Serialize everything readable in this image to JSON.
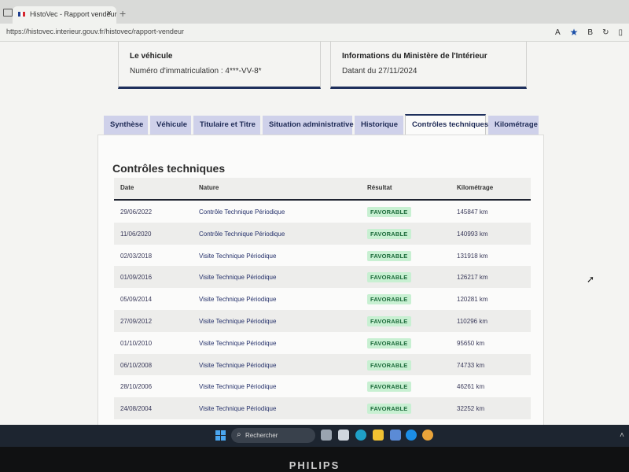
{
  "browser": {
    "tab_title": "HistoVec - Rapport vendeur",
    "tab_close": "×",
    "new_tab": "+",
    "url": "https://histovec.interieur.gouv.fr/histovec/rapport-vendeur",
    "toolbar": {
      "read_aloud": "A",
      "favorite": "★",
      "profile_b": "B",
      "refresh": "↻",
      "split": "▯"
    }
  },
  "cards": {
    "vehicle": {
      "title": "Le véhicule",
      "text": "Numéro d'immatriculation : 4***-VV-8*"
    },
    "ministry": {
      "title": "Informations du Ministère de l'Intérieur",
      "text": "Datant du 27/11/2024"
    }
  },
  "tabs": [
    {
      "label": "Synthèse"
    },
    {
      "label": "Véhicule"
    },
    {
      "label": "Titulaire et Titre"
    },
    {
      "label": "Situation administrative"
    },
    {
      "label": "Historique"
    },
    {
      "label": "Contrôles techniques",
      "active": true
    },
    {
      "label": "Kilométrage"
    }
  ],
  "section": {
    "title": "Contrôles techniques"
  },
  "table": {
    "headers": {
      "date": "Date",
      "nature": "Nature",
      "result": "Résultat",
      "km": "Kilométrage"
    },
    "rows": [
      {
        "date": "29/06/2022",
        "nature": "Contrôle Technique Périodique",
        "result": "FAVORABLE",
        "km": "145847 km"
      },
      {
        "date": "11/06/2020",
        "nature": "Contrôle Technique Périodique",
        "result": "FAVORABLE",
        "km": "140993 km"
      },
      {
        "date": "02/03/2018",
        "nature": "Visite Technique Périodique",
        "result": "FAVORABLE",
        "km": "131918 km"
      },
      {
        "date": "01/09/2016",
        "nature": "Visite Technique Périodique",
        "result": "FAVORABLE",
        "km": "126217 km"
      },
      {
        "date": "05/09/2014",
        "nature": "Visite Technique Périodique",
        "result": "FAVORABLE",
        "km": "120281 km"
      },
      {
        "date": "27/09/2012",
        "nature": "Visite Technique Périodique",
        "result": "FAVORABLE",
        "km": "110296 km"
      },
      {
        "date": "01/10/2010",
        "nature": "Visite Technique Périodique",
        "result": "FAVORABLE",
        "km": "95650 km"
      },
      {
        "date": "06/10/2008",
        "nature": "Visite Technique Périodique",
        "result": "FAVORABLE",
        "km": "74733 km"
      },
      {
        "date": "28/10/2006",
        "nature": "Visite Technique Périodique",
        "result": "FAVORABLE",
        "km": "46261 km"
      },
      {
        "date": "24/08/2004",
        "nature": "Visite Technique Périodique",
        "result": "FAVORABLE",
        "km": "32252 km"
      }
    ]
  },
  "taskbar": {
    "search_placeholder": "Rechercher",
    "apps": [
      {
        "icon": "task-view-icon",
        "color": "#9aa4b0"
      },
      {
        "icon": "widgets-icon",
        "color": "#cfd6de"
      },
      {
        "icon": "edge-icon",
        "color": "#1fa1c9"
      },
      {
        "icon": "file-explorer-icon",
        "color": "#f1c232"
      },
      {
        "icon": "store-icon",
        "color": "#5b8bd6"
      },
      {
        "icon": "skype-icon",
        "color": "#1c8ee6"
      },
      {
        "icon": "chrome-icon",
        "color": "#e8a33a"
      }
    ]
  },
  "monitor": {
    "brand": "PHILIPS"
  }
}
